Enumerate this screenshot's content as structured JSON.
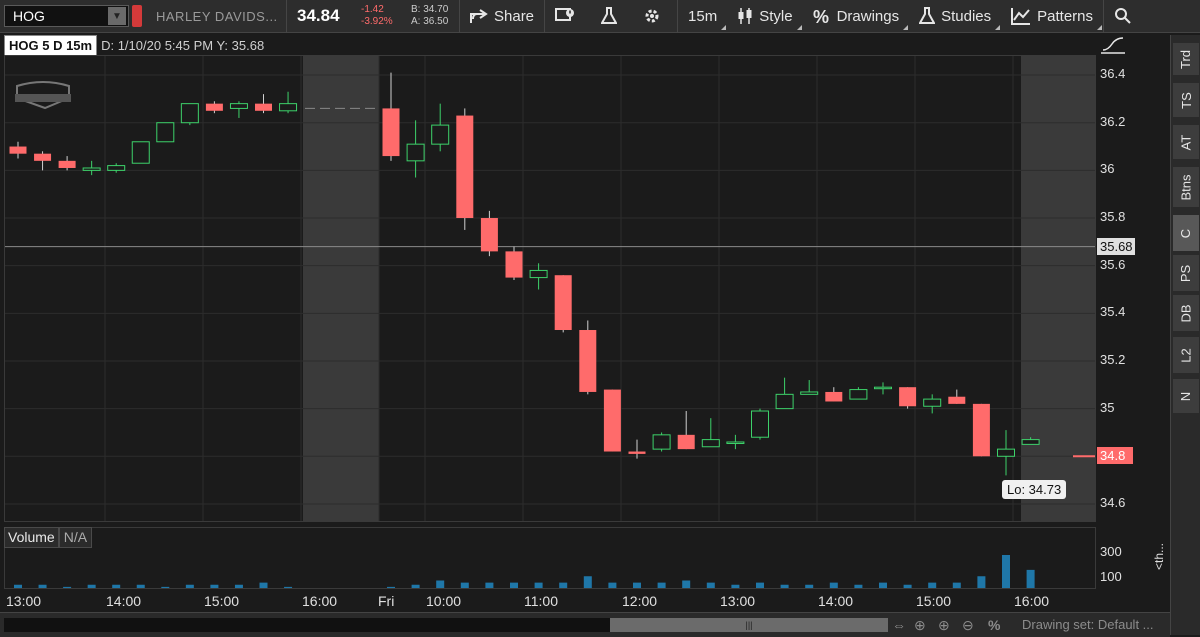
{
  "toolbar": {
    "symbol": "HOG",
    "company": "HARLEY DAVIDS...",
    "last_price": "34.84",
    "net_change": "-1.42",
    "pct_change": "-3.92%",
    "bid": "B: 34.70",
    "ask": "A: 36.50",
    "share_label": "Share",
    "timeframe_label": "15m",
    "style_label": "Style",
    "drawings_label": "Drawings",
    "studies_label": "Studies",
    "patterns_label": "Patterns"
  },
  "chart_header": {
    "symbol_period": "HOG 5 D 15m",
    "info": "D: 1/10/20 5:45 PM  Y: 35.68"
  },
  "right_tabs": [
    "Trd",
    "TS",
    "AT",
    "Btns",
    "C",
    "PS",
    "DB",
    "L2",
    "N"
  ],
  "volume_panel": {
    "title": "Volume",
    "value": "N/A",
    "tick_300": "300",
    "tick_100": "100",
    "truncated_label": "<th..."
  },
  "cursor_price": "35.68",
  "last_price_flag": "34.8",
  "low_tooltip": "Lo: 34.73",
  "bottom_bar": {
    "drawing_set": "Drawing set: Default ..."
  },
  "colors": {
    "up": "#3dd26a",
    "down": "#ff6b6b",
    "volume": "#1f77a8",
    "session_shade": "#3a3a3a"
  },
  "chart_data": {
    "type": "candlestick",
    "yticks": [
      34.6,
      34.8,
      35,
      35.2,
      35.4,
      35.6,
      35.8,
      36,
      36.2,
      36.4
    ],
    "ytick_labels": [
      "34.6",
      "34.8",
      "35",
      "35.2",
      "35.4",
      "35.6",
      "35.8",
      "36",
      "36.2",
      "36.4"
    ],
    "ylim": [
      34.52,
      36.48
    ],
    "xticks": [
      "13:00",
      "14:00",
      "15:00",
      "16:00",
      "Fri",
      "10:00",
      "11:00",
      "12:00",
      "13:00",
      "14:00",
      "15:00",
      "16:00"
    ],
    "candles": [
      {
        "o": 36.1,
        "h": 36.12,
        "l": 36.05,
        "c": 36.07
      },
      {
        "o": 36.07,
        "h": 36.08,
        "l": 36.0,
        "c": 36.04
      },
      {
        "o": 36.04,
        "h": 36.06,
        "l": 36.0,
        "c": 36.01
      },
      {
        "o": 36.0,
        "h": 36.04,
        "l": 35.98,
        "c": 36.01
      },
      {
        "o": 36.0,
        "h": 36.03,
        "l": 35.99,
        "c": 36.02
      },
      {
        "o": 36.03,
        "h": 36.12,
        "l": 36.03,
        "c": 36.12
      },
      {
        "o": 36.12,
        "h": 36.2,
        "l": 36.12,
        "c": 36.2
      },
      {
        "o": 36.2,
        "h": 36.28,
        "l": 36.19,
        "c": 36.28
      },
      {
        "o": 36.28,
        "h": 36.29,
        "l": 36.24,
        "c": 36.25
      },
      {
        "o": 36.26,
        "h": 36.29,
        "l": 36.22,
        "c": 36.28
      },
      {
        "o": 36.28,
        "h": 36.32,
        "l": 36.24,
        "c": 36.25
      },
      {
        "o": 36.25,
        "h": 36.33,
        "l": 36.24,
        "c": 36.28
      },
      {
        "o": 36.26,
        "h": 36.41,
        "l": 36.04,
        "c": 36.06
      },
      {
        "o": 36.04,
        "h": 36.21,
        "l": 35.97,
        "c": 36.11
      },
      {
        "o": 36.11,
        "h": 36.28,
        "l": 36.08,
        "c": 36.19
      },
      {
        "o": 36.23,
        "h": 36.26,
        "l": 35.75,
        "c": 35.8
      },
      {
        "o": 35.8,
        "h": 35.83,
        "l": 35.64,
        "c": 35.66
      },
      {
        "o": 35.66,
        "h": 35.68,
        "l": 35.54,
        "c": 35.55
      },
      {
        "o": 35.55,
        "h": 35.61,
        "l": 35.5,
        "c": 35.58
      },
      {
        "o": 35.56,
        "h": 35.56,
        "l": 35.32,
        "c": 35.33
      },
      {
        "o": 35.33,
        "h": 35.37,
        "l": 35.06,
        "c": 35.07
      },
      {
        "o": 35.08,
        "h": 35.08,
        "l": 34.82,
        "c": 34.82
      },
      {
        "o": 34.82,
        "h": 34.87,
        "l": 34.79,
        "c": 34.81
      },
      {
        "o": 34.83,
        "h": 34.9,
        "l": 34.82,
        "c": 34.89
      },
      {
        "o": 34.89,
        "h": 34.99,
        "l": 34.83,
        "c": 34.83
      },
      {
        "o": 34.84,
        "h": 34.96,
        "l": 34.84,
        "c": 34.87
      },
      {
        "o": 34.86,
        "h": 34.89,
        "l": 34.83,
        "c": 34.86
      },
      {
        "o": 34.88,
        "h": 35.0,
        "l": 34.87,
        "c": 34.99
      },
      {
        "o": 35.0,
        "h": 35.13,
        "l": 35.0,
        "c": 35.06
      },
      {
        "o": 35.06,
        "h": 35.12,
        "l": 35.06,
        "c": 35.07
      },
      {
        "o": 35.07,
        "h": 35.09,
        "l": 35.03,
        "c": 35.03
      },
      {
        "o": 35.04,
        "h": 35.09,
        "l": 35.04,
        "c": 35.08
      },
      {
        "o": 35.09,
        "h": 35.11,
        "l": 35.06,
        "c": 35.09
      },
      {
        "o": 35.09,
        "h": 35.09,
        "l": 35.0,
        "c": 35.01
      },
      {
        "o": 35.01,
        "h": 35.06,
        "l": 34.98,
        "c": 35.04
      },
      {
        "o": 35.05,
        "h": 35.08,
        "l": 35.02,
        "c": 35.02
      },
      {
        "o": 35.02,
        "h": 35.02,
        "l": 34.8,
        "c": 34.8
      },
      {
        "o": 34.8,
        "h": 34.91,
        "l": 34.72,
        "c": 34.83
      },
      {
        "o": 34.85,
        "h": 34.88,
        "l": 34.85,
        "c": 34.87
      }
    ],
    "volume": [
      2,
      2,
      1,
      2,
      2,
      2,
      1,
      2,
      2,
      2,
      3,
      1,
      1,
      2,
      4,
      3,
      3,
      3,
      3,
      3,
      6,
      3,
      3,
      3,
      4,
      3,
      2,
      3,
      2,
      2,
      3,
      2,
      3,
      2,
      3,
      3,
      6,
      16,
      9
    ],
    "volume_ticks": [
      100,
      300
    ],
    "volume_ylim": [
      0,
      340
    ],
    "reference_line": 35.68,
    "last_price_line": 34.8
  }
}
